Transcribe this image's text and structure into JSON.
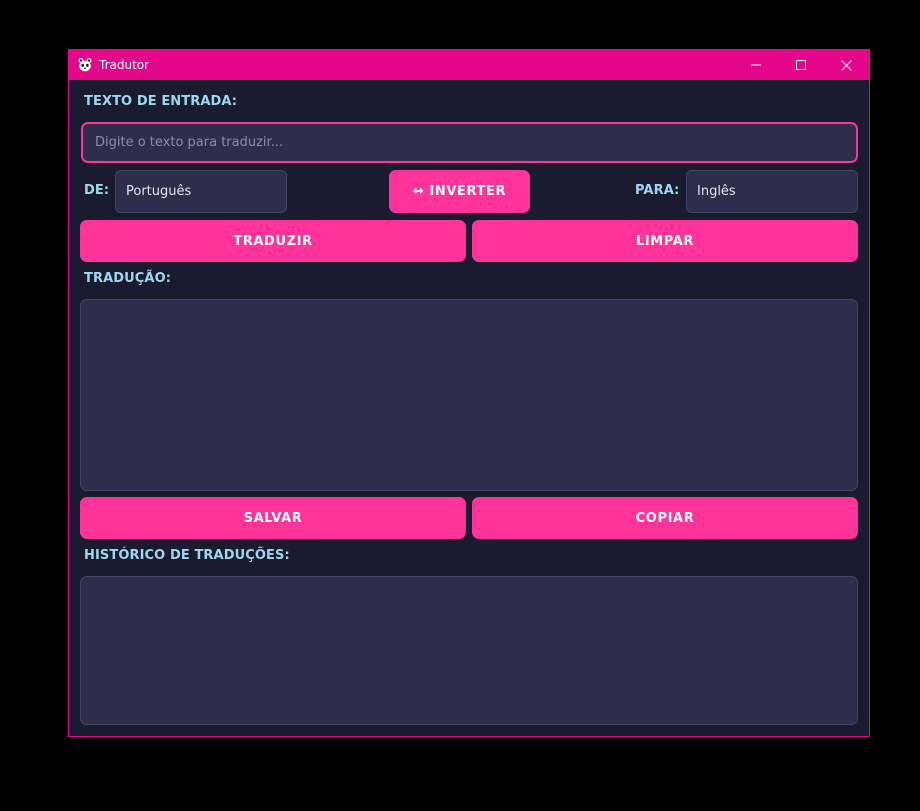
{
  "window": {
    "title": "Tradutor",
    "icon": "panda-icon"
  },
  "input_section": {
    "label": "TEXTO DE ENTRADA:",
    "value": "",
    "placeholder": "Digite o texto para traduzir..."
  },
  "languages": {
    "from_label": "DE:",
    "from_value": "Português",
    "swap_label": "↔ INVERTER",
    "to_label": "PARA:",
    "to_value": "Inglês"
  },
  "actions": {
    "translate_label": "TRADUZIR",
    "clear_label": "LIMPAR",
    "save_label": "SALVAR",
    "copy_label": "COPIAR"
  },
  "output_section": {
    "label": "TRADUÇÃO:",
    "value": ""
  },
  "history_section": {
    "label": "HISTÓRICO DE TRADUÇÕES:",
    "value": ""
  },
  "colors": {
    "accent": "#ff3399",
    "titlebar": "#e4078c",
    "background": "#1b1b2f",
    "field": "#2e2e4c",
    "label": "#9dd8f0"
  }
}
